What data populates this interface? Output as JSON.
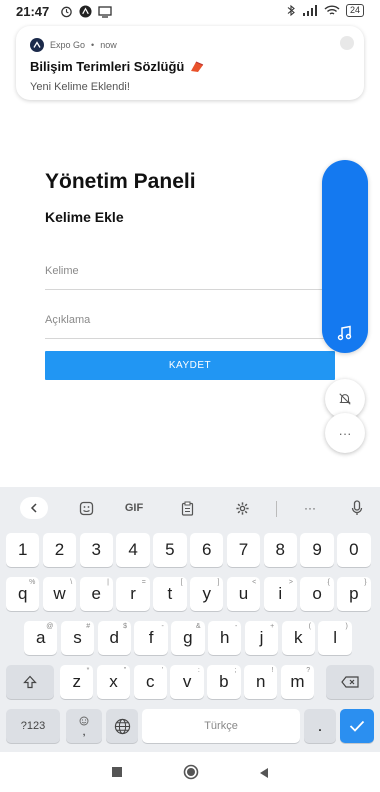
{
  "status_bar": {
    "time": "21:47",
    "battery": "24"
  },
  "notification": {
    "app": "Expo Go",
    "time": "now",
    "title": "Bilişim Terimleri Sözlüğü",
    "body": "Yeni Kelime Eklendi!"
  },
  "main": {
    "title": "Yönetim Paneli",
    "section": "Kelime Ekle",
    "word_placeholder": "Kelime",
    "description_placeholder": "Açıklama",
    "save_label": "KAYDET",
    "accent": "#2196f3"
  },
  "side_widget": {
    "more_label": "···",
    "color": "#1479f0"
  },
  "keyboard": {
    "toolbar": {
      "gif": "GIF",
      "more": "···"
    },
    "rows": [
      [
        {
          "k": "1"
        },
        {
          "k": "2"
        },
        {
          "k": "3"
        },
        {
          "k": "4"
        },
        {
          "k": "5"
        },
        {
          "k": "6"
        },
        {
          "k": "7"
        },
        {
          "k": "8"
        },
        {
          "k": "9"
        },
        {
          "k": "0"
        }
      ],
      [
        {
          "k": "q",
          "s": "%"
        },
        {
          "k": "w",
          "s": "\\"
        },
        {
          "k": "e",
          "s": "|"
        },
        {
          "k": "r",
          "s": "="
        },
        {
          "k": "t",
          "s": "["
        },
        {
          "k": "y",
          "s": "]"
        },
        {
          "k": "u",
          "s": "<"
        },
        {
          "k": "i",
          "s": ">"
        },
        {
          "k": "o",
          "s": "{"
        },
        {
          "k": "p",
          "s": "}"
        }
      ],
      [
        {
          "k": "a",
          "s": "@"
        },
        {
          "k": "s",
          "s": "#"
        },
        {
          "k": "d",
          "s": "$"
        },
        {
          "k": "f",
          "s": "-"
        },
        {
          "k": "g",
          "s": "&"
        },
        {
          "k": "h",
          "s": "-"
        },
        {
          "k": "j",
          "s": "+"
        },
        {
          "k": "k",
          "s": "("
        },
        {
          "k": "l",
          "s": ")"
        }
      ],
      [
        {
          "k": "z",
          "s": "*"
        },
        {
          "k": "x",
          "s": "\""
        },
        {
          "k": "c",
          "s": "'"
        },
        {
          "k": "v",
          "s": ":"
        },
        {
          "k": "b",
          "s": ";"
        },
        {
          "k": "n",
          "s": "!"
        },
        {
          "k": "m",
          "s": "?"
        }
      ]
    ],
    "symbols_label": "?123",
    "comma_label": ",",
    "space_label": "Türkçe",
    "period_label": "."
  }
}
